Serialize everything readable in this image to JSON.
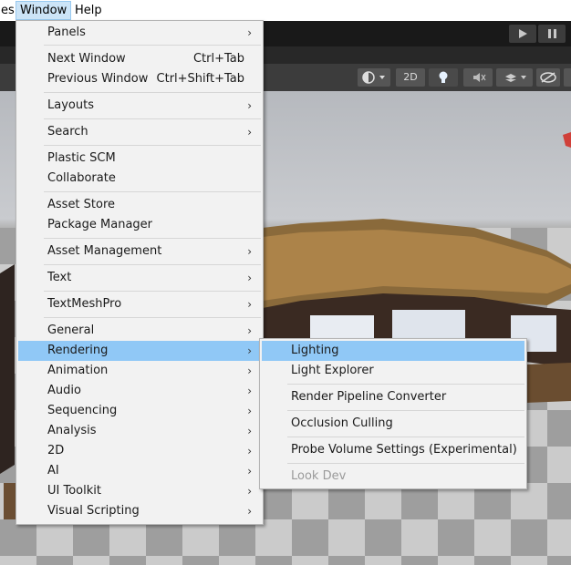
{
  "menubar": {
    "items": [
      {
        "label": "es"
      },
      {
        "label": "Window"
      },
      {
        "label": "Help"
      }
    ]
  },
  "scene_toolbar": {
    "mode_2d": "2D"
  },
  "window_menu": {
    "items": [
      {
        "label": "Panels",
        "submenu": true
      },
      {
        "label": "Next Window",
        "shortcut": "Ctrl+Tab"
      },
      {
        "label": "Previous Window",
        "shortcut": "Ctrl+Shift+Tab"
      },
      {
        "label": "Layouts",
        "submenu": true
      },
      {
        "label": "Search",
        "submenu": true
      },
      {
        "label": "Plastic SCM"
      },
      {
        "label": "Collaborate"
      },
      {
        "label": "Asset Store"
      },
      {
        "label": "Package Manager"
      },
      {
        "label": "Asset Management",
        "submenu": true
      },
      {
        "label": "Text",
        "submenu": true
      },
      {
        "label": "TextMeshPro",
        "submenu": true
      },
      {
        "label": "General",
        "submenu": true
      },
      {
        "label": "Rendering",
        "submenu": true,
        "highlighted": true
      },
      {
        "label": "Animation",
        "submenu": true
      },
      {
        "label": "Audio",
        "submenu": true
      },
      {
        "label": "Sequencing",
        "submenu": true
      },
      {
        "label": "Analysis",
        "submenu": true
      },
      {
        "label": "2D",
        "submenu": true
      },
      {
        "label": "AI",
        "submenu": true
      },
      {
        "label": "UI Toolkit",
        "submenu": true
      },
      {
        "label": "Visual Scripting",
        "submenu": true
      }
    ]
  },
  "rendering_submenu": {
    "items": [
      {
        "label": "Lighting",
        "highlighted": true
      },
      {
        "label": "Light Explorer"
      },
      {
        "label": "Render Pipeline Converter"
      },
      {
        "label": "Occlusion Culling"
      },
      {
        "label": "Probe Volume Settings (Experimental)"
      },
      {
        "label": "Look Dev",
        "disabled": true
      }
    ]
  },
  "colors": {
    "highlight": "#90c8f6",
    "menu_bg": "#f2f2f2",
    "active_menubar": "#cce4f7"
  },
  "icons": [
    "play-icon",
    "pause-icon",
    "shading-mode-icon",
    "lightbulb-icon",
    "audio-mute-icon",
    "effects-icon",
    "visibility-icon",
    "chevron-right-icon"
  ]
}
